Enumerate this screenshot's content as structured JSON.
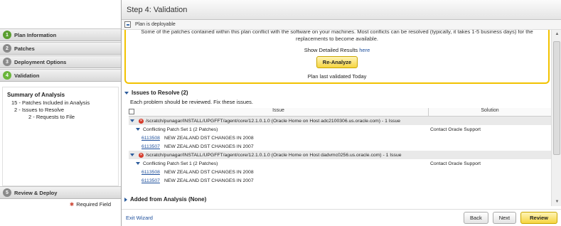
{
  "wizard": {
    "steps": [
      {
        "num": "1",
        "label": "Plan Information"
      },
      {
        "num": "2",
        "label": "Patches"
      },
      {
        "num": "3",
        "label": "Deployment Options"
      },
      {
        "num": "4",
        "label": "Validation"
      },
      {
        "num": "5",
        "label": "Review & Deploy"
      }
    ],
    "required_label": "Required Field"
  },
  "summary": {
    "title": "Summary of Analysis",
    "rows": [
      {
        "count": "15",
        "text": "- Patches Included in Analysis"
      },
      {
        "count": "2",
        "text": "- Issues to Resolve"
      },
      {
        "count": "2",
        "text": "- Requests to File"
      }
    ]
  },
  "header": {
    "title": "Step 4: Validation",
    "status": "Plan is deployable"
  },
  "validation": {
    "message": "Some of the patches contained within this plan conflict with the software on your machines.  Most conflicts can be resolved (typically, it takes 1-5 business days) for the replacements to become available.",
    "detail_label": "Show Detailed Results",
    "detail_link": "here",
    "reanalyze_label": "Re-Analyze",
    "last_validated": "Plan last validated Today"
  },
  "issues": {
    "title": "Issues to Resolve (2)",
    "description": "Each problem should be reviewed. Fix these issues.",
    "col_issue": "Issue",
    "col_solution": "Solution",
    "groups": [
      {
        "path": "/scratch/punagar/INSTALL/UPGFFT/agent/core/12.1.0.1.0 (Oracle Home on Host adc2100306.us.oracle.com) - 1 Issue",
        "conflict": "Conflicting Patch Set 1 (2 Patches)",
        "solution": "Contact Oracle Support",
        "patches": [
          {
            "id": "6113508",
            "desc": "NEW ZEALAND DST CHANGES IN 2008"
          },
          {
            "id": "6113507",
            "desc": "NEW ZEALAND DST CHANGES IN 2007"
          }
        ]
      },
      {
        "path": "/scratch/punagar/INSTALL/UPGFFT/agent/core/12.1.0.1.0 (Oracle Home on Host dadvmc0256.us.oracle.com) - 1 Issue",
        "conflict": "Conflicting Patch Set 1 (2 Patches)",
        "solution": "Contact Oracle Support",
        "patches": [
          {
            "id": "6113508",
            "desc": "NEW ZEALAND DST CHANGES IN 2008"
          },
          {
            "id": "6113507",
            "desc": "NEW ZEALAND DST CHANGES IN 2007"
          }
        ]
      }
    ]
  },
  "added": {
    "title": "Added from Analysis (None)"
  },
  "footer": {
    "exit_label": "Exit Wizard",
    "back_label": "Back",
    "next_label": "Next",
    "review_label": "Review"
  }
}
